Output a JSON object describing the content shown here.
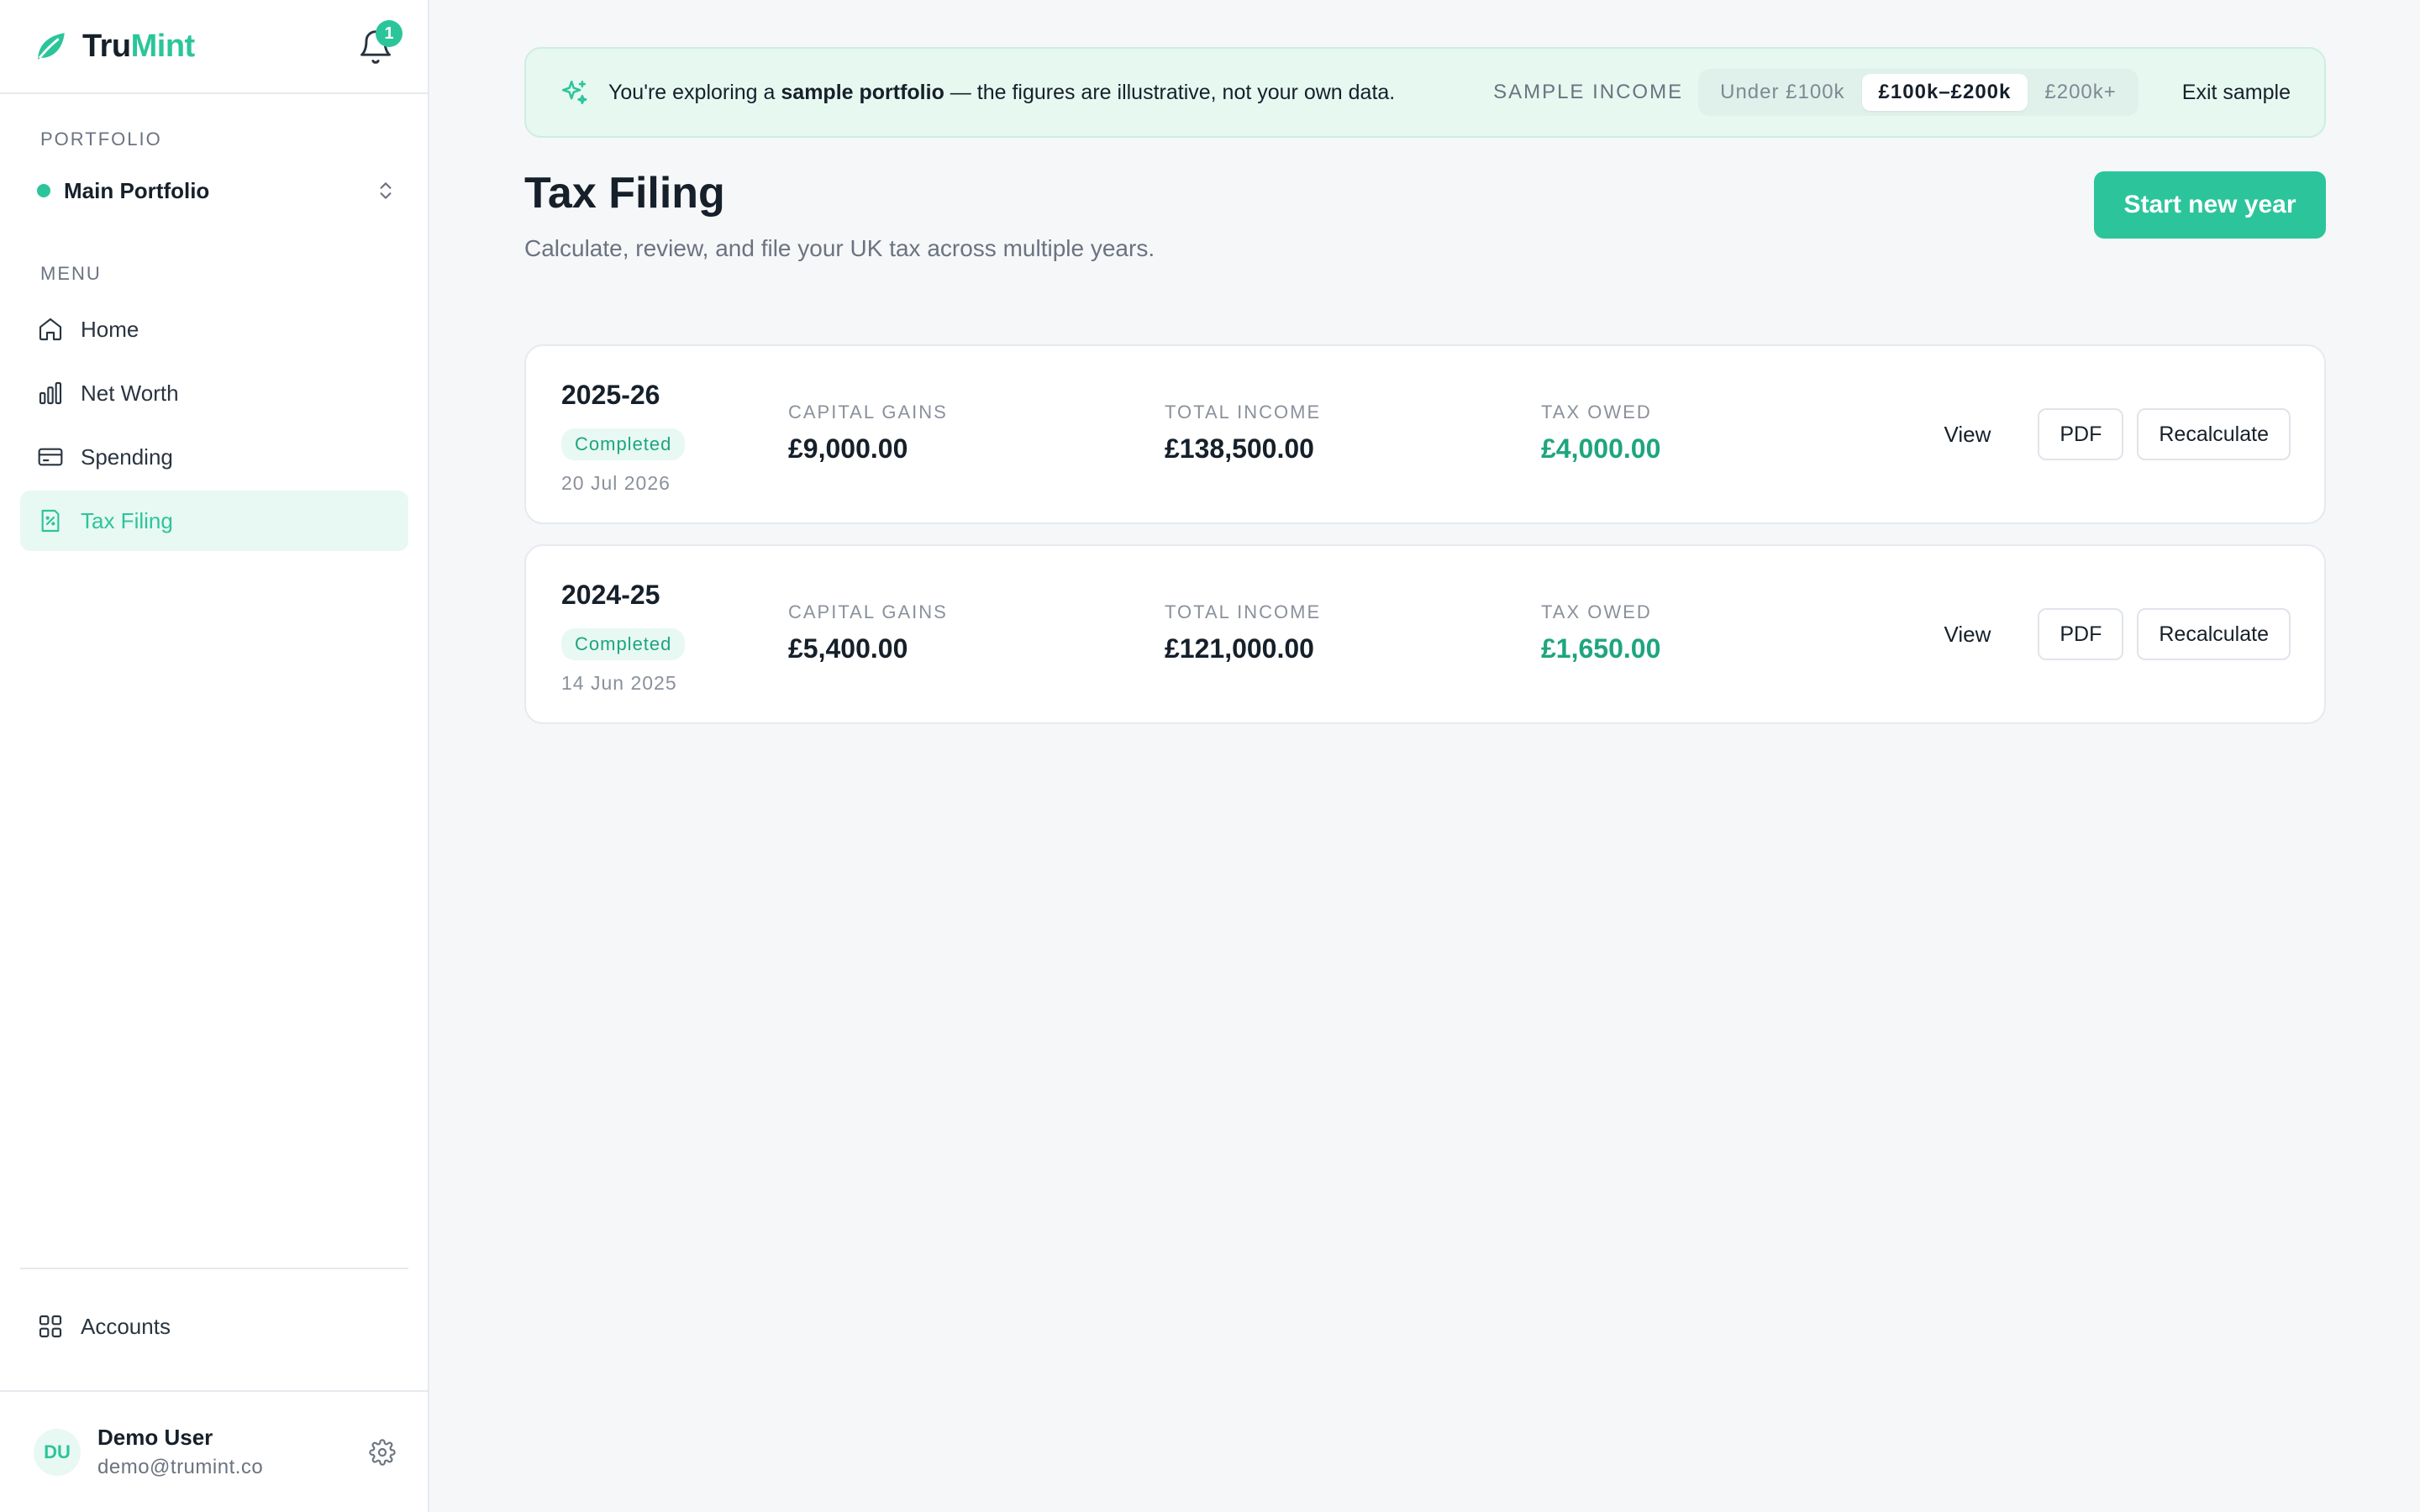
{
  "brand": {
    "name_part1": "Tru",
    "name_part2": "Mint",
    "notification_count": "1"
  },
  "sidebar": {
    "portfolio_label": "PORTFOLIO",
    "portfolio_name": "Main Portfolio",
    "menu_label": "MENU",
    "items": [
      {
        "label": "Home",
        "icon": "home-icon"
      },
      {
        "label": "Net Worth",
        "icon": "bar-chart-icon"
      },
      {
        "label": "Spending",
        "icon": "credit-card-icon"
      },
      {
        "label": "Tax Filing",
        "icon": "receipt-icon",
        "active": true
      }
    ],
    "accounts_label": "Accounts",
    "user": {
      "initials": "DU",
      "name": "Demo User",
      "email": "demo@trumint.co"
    }
  },
  "banner": {
    "prefix": "You're exploring a ",
    "bold": "sample portfolio",
    "suffix": " — the figures are illustrative, not your own data.",
    "income_label": "SAMPLE INCOME",
    "options": [
      "Under £100k",
      "£100k–£200k",
      "£200k+"
    ],
    "selected": "£100k–£200k",
    "exit_label": "Exit sample"
  },
  "page": {
    "title": "Tax Filing",
    "subtitle": "Calculate, review, and file your UK tax across multiple years.",
    "start_button": "Start new year"
  },
  "labels": {
    "capital_gains": "CAPITAL GAINS",
    "total_income": "TOTAL INCOME",
    "tax_owed": "TAX OWED",
    "view": "View",
    "pdf": "PDF",
    "recalculate": "Recalculate"
  },
  "years": [
    {
      "year": "2025-26",
      "status": "Completed",
      "date": "20 Jul 2026",
      "capital_gains": "£9,000.00",
      "total_income": "£138,500.00",
      "tax_owed": "£4,000.00"
    },
    {
      "year": "2024-25",
      "status": "Completed",
      "date": "14 Jun 2025",
      "capital_gains": "£5,400.00",
      "total_income": "£121,000.00",
      "tax_owed": "£1,650.00"
    }
  ],
  "colors": {
    "accent": "#2cc59b",
    "positive": "#1ea57e",
    "banner_bg": "#e7f8f1"
  }
}
